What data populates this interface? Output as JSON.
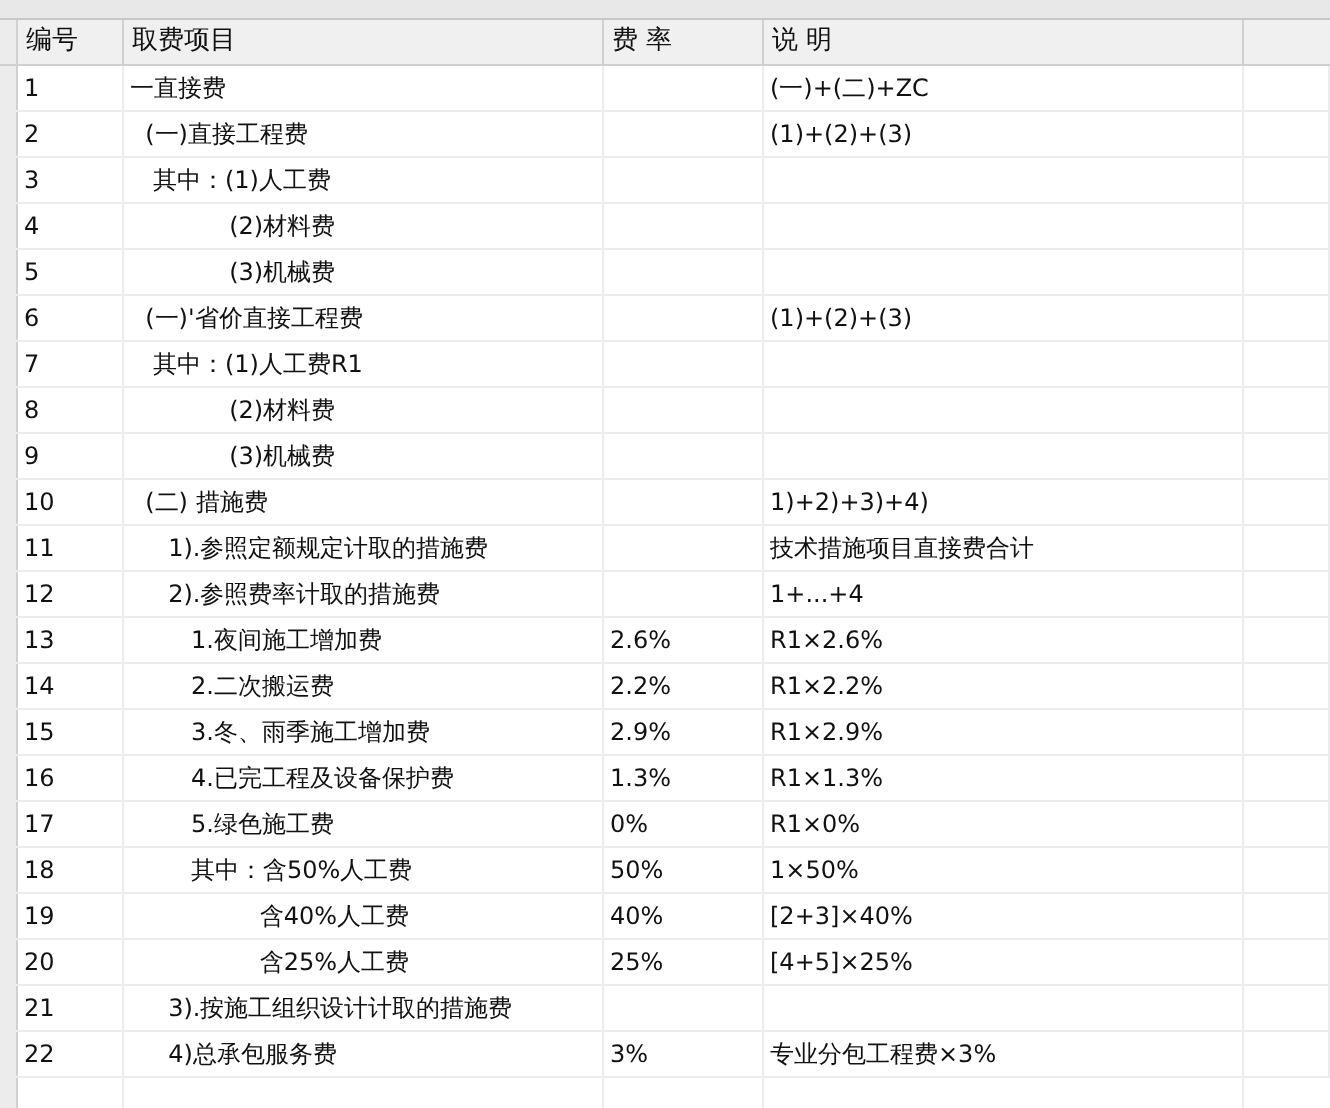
{
  "table": {
    "columns": [
      "编号",
      "取费项目",
      "费 率",
      "说 明"
    ],
    "rows": [
      {
        "cells": [
          "1",
          "一直接费",
          "",
          "(一)+(二)+ZC"
        ]
      },
      {
        "cells": [
          "2",
          "  (一)直接工程费",
          "",
          "(1)+(2)+(3)"
        ]
      },
      {
        "cells": [
          "3",
          "   其中：(1)人工费",
          "",
          ""
        ]
      },
      {
        "cells": [
          "4",
          "             (2)材料费",
          "",
          ""
        ]
      },
      {
        "cells": [
          "5",
          "             (3)机械费",
          "",
          ""
        ]
      },
      {
        "cells": [
          "6",
          "  (一)'省价直接工程费",
          "",
          "(1)+(2)+(3)"
        ]
      },
      {
        "cells": [
          "7",
          "   其中：(1)人工费R1",
          "",
          ""
        ]
      },
      {
        "cells": [
          "8",
          "             (2)材料费",
          "",
          ""
        ]
      },
      {
        "cells": [
          "9",
          "             (3)机械费",
          "",
          ""
        ]
      },
      {
        "cells": [
          "10",
          "  (二) 措施费",
          "",
          "1)+2)+3)+4)"
        ]
      },
      {
        "cells": [
          "11",
          "     1).参照定额规定计取的措施费",
          "",
          "技术措施项目直接费合计"
        ]
      },
      {
        "cells": [
          "12",
          "     2).参照费率计取的措施费",
          "",
          "1+...+4"
        ]
      },
      {
        "cells": [
          "13",
          "        1.夜间施工增加费",
          "2.6%",
          "R1×2.6%"
        ]
      },
      {
        "cells": [
          "14",
          "        2.二次搬运费",
          "2.2%",
          "R1×2.2%"
        ]
      },
      {
        "cells": [
          "15",
          "        3.冬、雨季施工增加费",
          "2.9%",
          "R1×2.9%"
        ]
      },
      {
        "cells": [
          "16",
          "        4.已完工程及设备保护费",
          "1.3%",
          "R1×1.3%"
        ]
      },
      {
        "cells": [
          "17",
          "        5.绿色施工费",
          "0%",
          "R1×0%"
        ]
      },
      {
        "cells": [
          "18",
          "        其中：含50%人工费",
          "50%",
          "1×50%"
        ]
      },
      {
        "cells": [
          "19",
          "                 含40%人工费",
          "40%",
          "[2+3]×40%"
        ]
      },
      {
        "cells": [
          "20",
          "                 含25%人工费",
          "25%",
          "[4+5]×25%"
        ]
      },
      {
        "cells": [
          "21",
          "     3).按施工组织设计计取的措施费",
          "",
          ""
        ]
      },
      {
        "cells": [
          "22",
          "     4)总承包服务费",
          "3%",
          "专业分包工程费×3%"
        ]
      }
    ]
  }
}
